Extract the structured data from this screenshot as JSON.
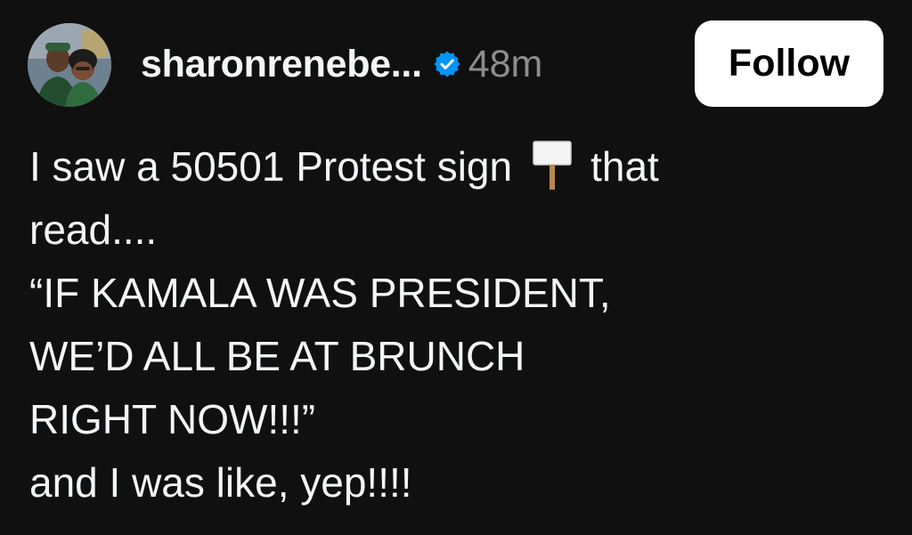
{
  "post": {
    "author": {
      "username": "sharonrenebe...",
      "verified": true,
      "avatar_icon": "profile-photo-two-people"
    },
    "timestamp": "48m",
    "follow_label": "Follow",
    "body": {
      "line1_before_icon": "I saw a 50501 Protest sign",
      "line1_icon": "placard-icon",
      "line1_after_icon": "that",
      "line2": "read....",
      "line3": "“IF KAMALA WAS PRESIDENT,",
      "line4": "WE’D ALL BE AT BRUNCH",
      "line5": "RIGHT NOW!!!”",
      "line6": "and I was like, yep!!!!"
    }
  },
  "colors": {
    "background": "#101010",
    "text_primary": "#f3f5f7",
    "text_secondary": "#8d8d8d",
    "verified_blue": "#0095f6",
    "follow_button_bg": "#ffffff",
    "follow_button_text": "#000000"
  }
}
